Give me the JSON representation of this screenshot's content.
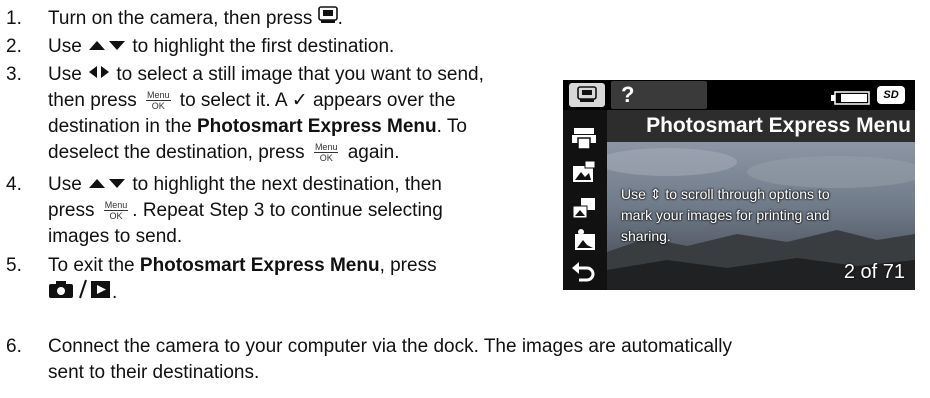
{
  "steps": [
    {
      "num": "1.",
      "lines": [
        [
          "Turn on the camera, then press ",
          "."
        ]
      ]
    },
    {
      "num": "2.",
      "lines": [
        [
          "Use ",
          " to highlight the first destination."
        ]
      ]
    },
    {
      "num": "3.",
      "lines": [
        [
          "Use ",
          " to select a still image that you want to send,"
        ],
        [
          "then press ",
          " to select it. A ",
          " appears over the"
        ],
        [
          "destination in the ",
          "Photosmart Express Menu",
          ". To"
        ],
        [
          "deselect the destination, press ",
          " again."
        ]
      ]
    },
    {
      "num": "4.",
      "lines": [
        [
          "Use ",
          " to highlight the next destination, then"
        ],
        [
          "press ",
          ". Repeat Step 3 to continue selecting"
        ],
        [
          "images to send."
        ]
      ]
    },
    {
      "num": "5.",
      "lines": [
        [
          "To exit the ",
          "Photosmart Express Menu",
          ", press"
        ],
        [
          "."
        ]
      ]
    },
    {
      "num": "6.",
      "lines": [
        [
          "Connect the camera to your computer via the dock. The images are automatically"
        ],
        [
          "sent to their destinations."
        ]
      ]
    }
  ],
  "menu_ok": {
    "top": "Menu",
    "bottom": "OK"
  },
  "checkmark": "✓",
  "camera_screen": {
    "help_glyph": "?",
    "title": "Photosmart Express Menu",
    "overlay_lines": [
      "Use ⇕ to scroll through options to",
      "mark your images for printing and",
      "sharing."
    ],
    "counter": "2 of 71",
    "sd_label": "SD",
    "sidebar_icons": [
      "print-icon",
      "share-icon",
      "send-image-icon",
      "buy-prints-icon",
      "back-arrow-icon"
    ]
  }
}
